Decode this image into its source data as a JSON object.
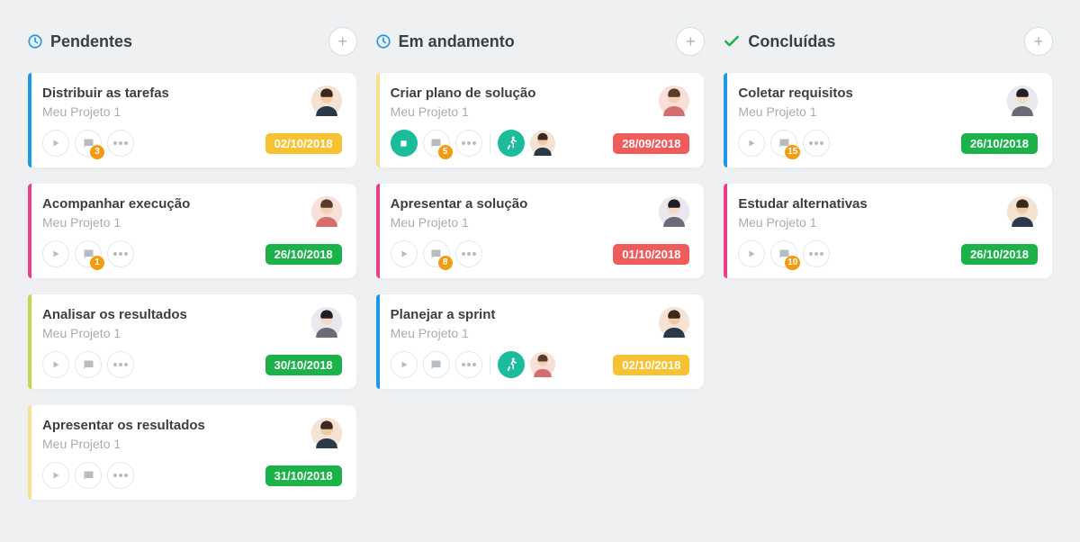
{
  "colors": {
    "blue": "#1c99e6",
    "green": "#1bb24a",
    "red": "#f05c5c",
    "yellow": "#f7c232",
    "pink": "#e83e8c",
    "orange_badge": "#f39c12",
    "teal": "#1abc9c",
    "lime": "#c0d94c",
    "stripe_yellow": "#f9e08e"
  },
  "columns": [
    {
      "id": "pending",
      "title": "Pendentes",
      "icon": "clock",
      "icon_color": "blue",
      "cards": [
        {
          "title": "Distribuir as tarefas",
          "project": "Meu Projeto 1",
          "stripe": "blue",
          "play_style": "plain",
          "comments": 3,
          "running": false,
          "date": "02/10/2018",
          "date_color": "yellow",
          "avatar": "m1"
        },
        {
          "title": "Acompanhar execução",
          "project": "Meu Projeto 1",
          "stripe": "pink",
          "play_style": "plain",
          "comments": 1,
          "running": false,
          "date": "26/10/2018",
          "date_color": "green",
          "avatar": "f1"
        },
        {
          "title": "Analisar os resultados",
          "project": "Meu Projeto 1",
          "stripe": "lime",
          "play_style": "plain",
          "comments": null,
          "running": false,
          "date": "30/10/2018",
          "date_color": "green",
          "avatar": "f2"
        },
        {
          "title": "Apresentar os resultados",
          "project": "Meu Projeto 1",
          "stripe": "stripe_yellow",
          "play_style": "plain",
          "comments": null,
          "running": false,
          "date": "31/10/2018",
          "date_color": "green",
          "avatar": "m1"
        }
      ]
    },
    {
      "id": "progress",
      "title": "Em andamento",
      "icon": "clock",
      "icon_color": "blue",
      "cards": [
        {
          "title": "Criar plano de solução",
          "project": "Meu Projeto 1",
          "stripe": "stripe_yellow",
          "play_style": "green_stop",
          "comments": 5,
          "running": true,
          "assignees": [
            "m1"
          ],
          "date": "28/09/2018",
          "date_color": "red",
          "avatar": "f1"
        },
        {
          "title": "Apresentar a solução",
          "project": "Meu Projeto 1",
          "stripe": "pink",
          "play_style": "plain",
          "comments": 8,
          "running": false,
          "date": "01/10/2018",
          "date_color": "red",
          "avatar": "f2"
        },
        {
          "title": "Planejar a sprint",
          "project": "Meu Projeto 1",
          "stripe": "blue",
          "play_style": "plain",
          "comments": null,
          "running": true,
          "assignees": [
            "f1"
          ],
          "date": "02/10/2018",
          "date_color": "yellow",
          "avatar": "m1"
        }
      ]
    },
    {
      "id": "done",
      "title": "Concluídas",
      "icon": "check",
      "icon_color": "green",
      "cards": [
        {
          "title": "Coletar requisitos",
          "project": "Meu Projeto 1",
          "stripe": "blue",
          "play_style": "plain",
          "comments": 15,
          "running": false,
          "date": "26/10/2018",
          "date_color": "green",
          "avatar": "f2"
        },
        {
          "title": "Estudar alternativas",
          "project": "Meu Projeto 1",
          "stripe": "pink",
          "play_style": "plain",
          "comments": 10,
          "running": false,
          "date": "26/10/2018",
          "date_color": "green",
          "avatar": "m1"
        }
      ]
    }
  ]
}
